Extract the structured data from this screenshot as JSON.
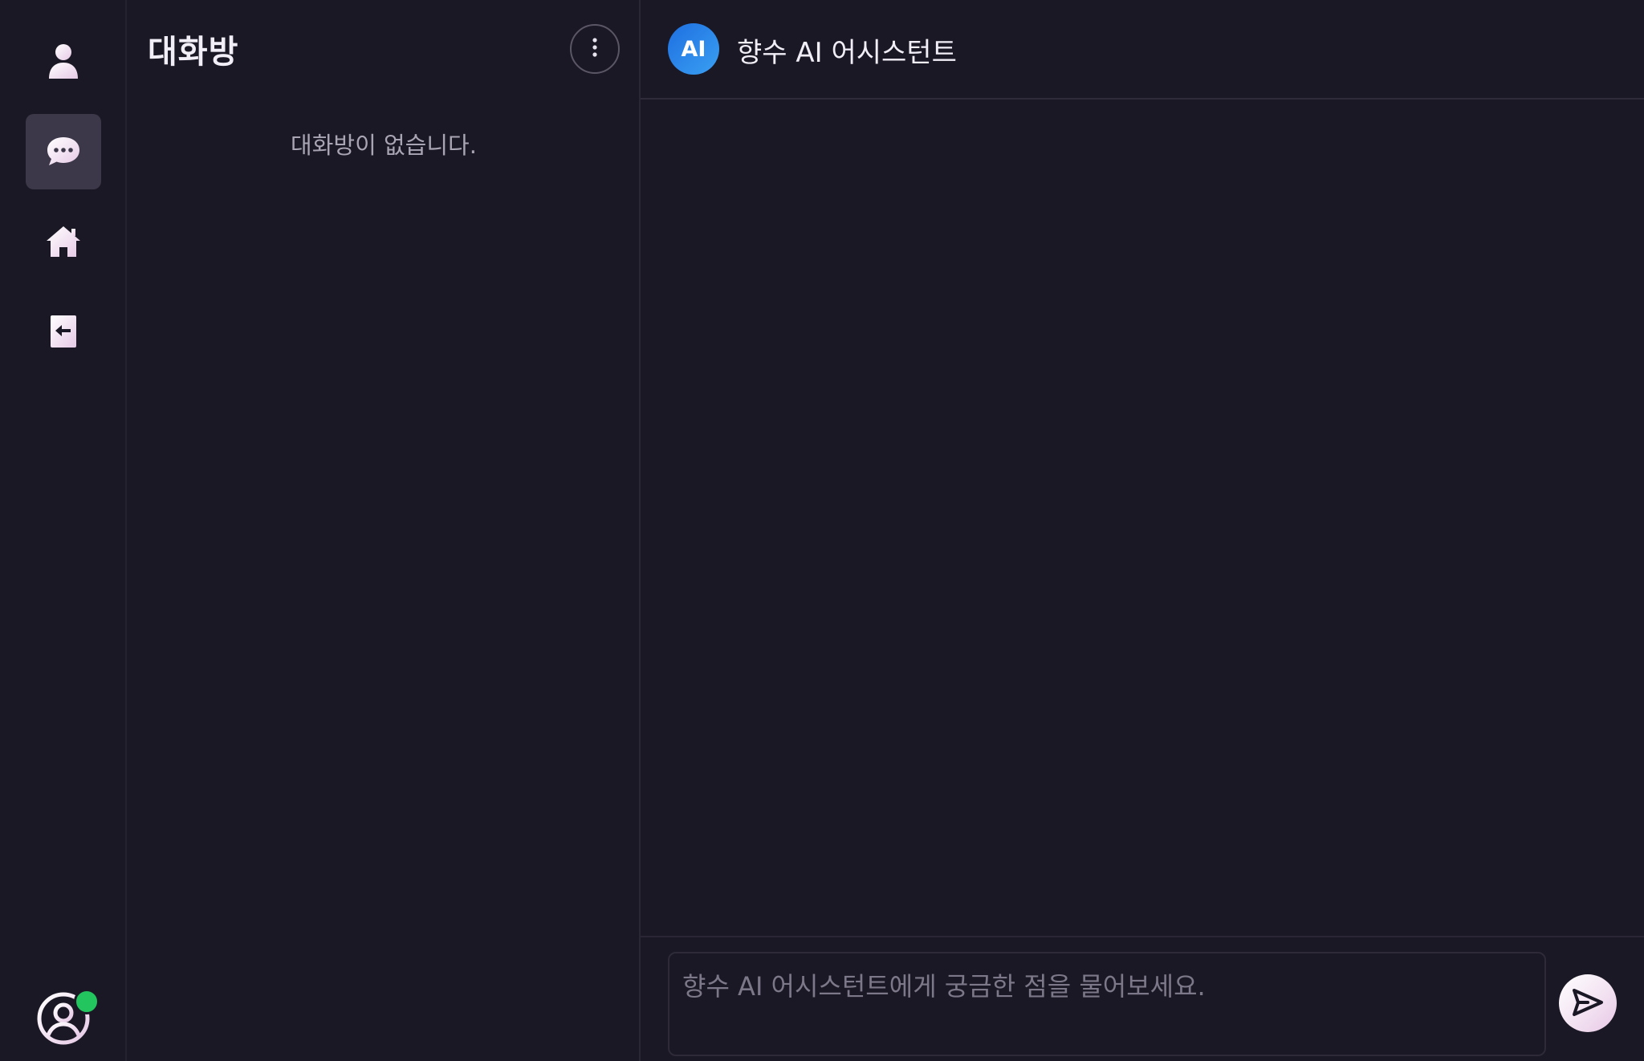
{
  "rail": {
    "items": [
      {
        "name": "profile",
        "icon": "user-icon",
        "active": false
      },
      {
        "name": "chat",
        "icon": "chat-bubble-icon",
        "active": true
      },
      {
        "name": "home",
        "icon": "home-icon",
        "active": false
      },
      {
        "name": "logout",
        "icon": "logout-icon",
        "active": false
      }
    ],
    "user_status": "online"
  },
  "rooms": {
    "title": "대화방",
    "empty_message": "대화방이 없습니다."
  },
  "chat": {
    "avatar_label": "AI",
    "title": "향수 AI 어시스턴트",
    "input_placeholder": "향수 AI 어시스턴트에게 궁금한 점을 물어보세요.",
    "input_value": ""
  },
  "colors": {
    "background": "#1b1825",
    "active_rail": "#3d3849",
    "ai_avatar": "#2a86ea",
    "online": "#22c55e"
  }
}
